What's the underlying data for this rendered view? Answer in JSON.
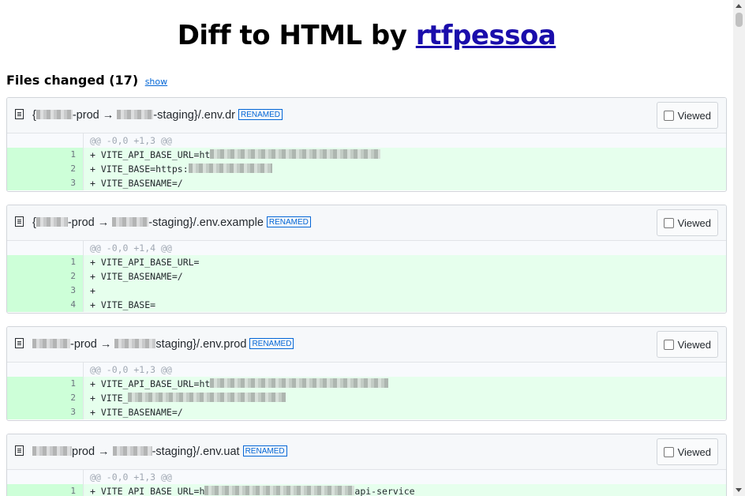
{
  "title": {
    "prefix": "Diff to HTML by ",
    "link": "rtfpessoa"
  },
  "files_changed": {
    "label": "Files changed (17)",
    "toggle": "show"
  },
  "viewed_label": "Viewed",
  "renamed_badge": "RENAMED",
  "files": [
    {
      "name_parts": [
        "{",
        "-prod → ",
        "-staging}/.env.dr"
      ],
      "hunk": "@@ -0,0 +1,3 @@",
      "lines": [
        {
          "num": "1",
          "text": "+ VITE_API_BASE_URL=ht"
        },
        {
          "num": "2",
          "text": "+ VITE_BASE=https:"
        },
        {
          "num": "3",
          "text": "+ VITE_BASENAME=/"
        }
      ]
    },
    {
      "name_parts": [
        "{",
        "-prod → ",
        "-staging}/.env.example"
      ],
      "hunk": "@@ -0,0 +1,4 @@",
      "lines": [
        {
          "num": "1",
          "text": "+ VITE_API_BASE_URL="
        },
        {
          "num": "2",
          "text": "+ VITE_BASENAME=/"
        },
        {
          "num": "3",
          "text": "+"
        },
        {
          "num": "4",
          "text": "+ VITE_BASE="
        }
      ]
    },
    {
      "name_parts": [
        "",
        "-prod → ",
        "staging}/.env.prod"
      ],
      "hunk": "@@ -0,0 +1,3 @@",
      "lines": [
        {
          "num": "1",
          "text": "+ VITE_API_BASE_URL=ht"
        },
        {
          "num": "2",
          "text": "+ VITE_"
        },
        {
          "num": "3",
          "text": "+ VITE_BASENAME=/"
        }
      ]
    },
    {
      "name_parts": [
        "",
        "prod → ",
        "-staging}/.env.uat"
      ],
      "hunk": "@@ -0,0 +1,3 @@",
      "lines": [
        {
          "num": "1",
          "text": "+ VITE_API_BASE_URL=h"
        },
        {
          "num": "",
          "text": "api-service"
        }
      ]
    }
  ]
}
